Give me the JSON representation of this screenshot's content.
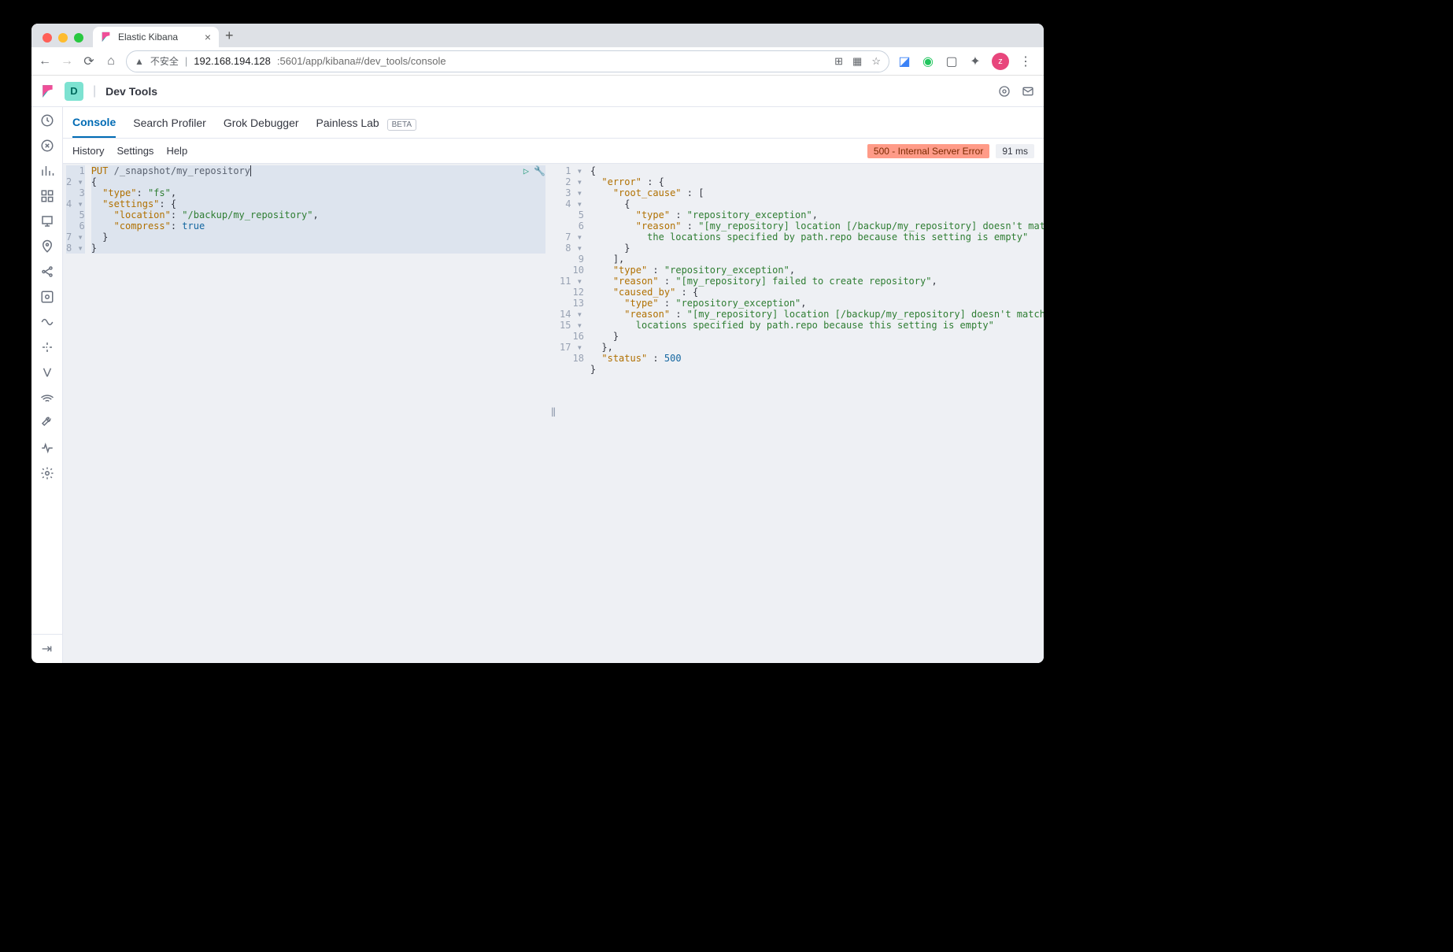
{
  "browser": {
    "tab_title": "Elastic Kibana",
    "warn_label": "不安全",
    "url_host": "192.168.194.128",
    "url_port_path": ":5601/app/kibana#/dev_tools/console",
    "avatar_letter": "z"
  },
  "kibana": {
    "space_letter": "D",
    "page_title": "Dev Tools",
    "tabs": {
      "console": "Console",
      "search_profiler": "Search Profiler",
      "grok": "Grok Debugger",
      "painless": "Painless Lab",
      "beta": "BETA"
    },
    "subbar": {
      "history": "History",
      "settings": "Settings",
      "help": "Help",
      "error_badge": "500 - Internal Server Error",
      "ms_badge": "91 ms"
    }
  },
  "request": {
    "method": "PUT",
    "path": "/_snapshot/my_repository",
    "body": {
      "type": "fs",
      "settings": {
        "location": "/backup/my_repository",
        "compress": true
      }
    },
    "raw_lines": [
      "PUT /_snapshot/my_repository",
      "{",
      "  \"type\": \"fs\",",
      "  \"settings\": {",
      "    \"location\": \"/backup/my_repository\",",
      "    \"compress\": true",
      "  }",
      "}"
    ]
  },
  "response": {
    "status": 500,
    "body": {
      "error": {
        "root_cause": [
          {
            "type": "repository_exception",
            "reason": "[my_repository] location [/backup/my_repository] doesn't match any of the locations specified by path.repo because this setting is empty"
          }
        ],
        "type": "repository_exception",
        "reason": "[my_repository] failed to create repository",
        "caused_by": {
          "type": "repository_exception",
          "reason": "[my_repository] location [/backup/my_repository] doesn't match any of the locations specified by path.repo because this setting is empty"
        }
      },
      "status": 500
    }
  }
}
